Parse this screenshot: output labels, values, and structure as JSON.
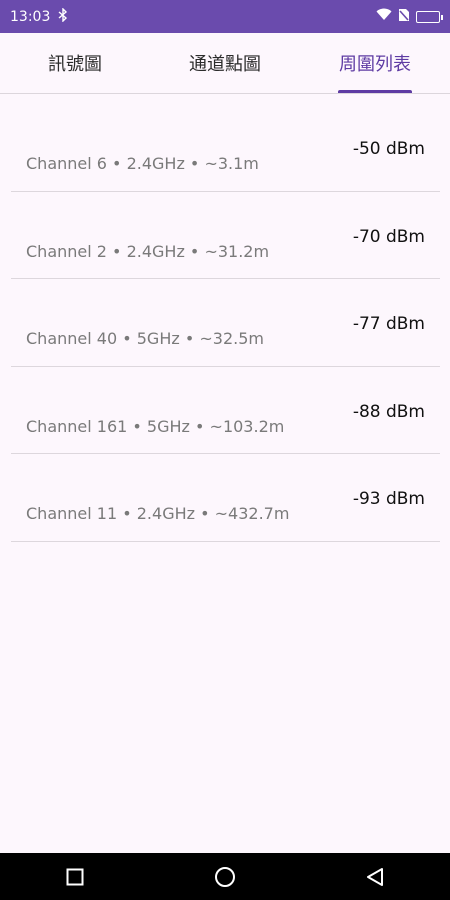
{
  "status_bar": {
    "time": "13:03"
  },
  "tabs": [
    {
      "label": "訊號圖",
      "active": false
    },
    {
      "label": "通道點圖",
      "active": false
    },
    {
      "label": "周圍列表",
      "active": true
    }
  ],
  "networks": [
    {
      "rssi": "-50 dBm",
      "meta": "Channel 6 • 2.4GHz • ~3.1m"
    },
    {
      "rssi": "-70 dBm",
      "meta": "Channel 2 • 2.4GHz • ~31.2m"
    },
    {
      "rssi": "-77 dBm",
      "meta": "Channel 40 • 5GHz • ~32.5m"
    },
    {
      "rssi": "-88 dBm",
      "meta": "Channel 161 • 5GHz • ~103.2m"
    },
    {
      "rssi": "-93 dBm",
      "meta": "Channel 11 • 2.4GHz • ~432.7m"
    }
  ],
  "colors": {
    "status_bar": "#6a4bad",
    "accent": "#5e3ba3",
    "background": "#fdf7fd"
  }
}
